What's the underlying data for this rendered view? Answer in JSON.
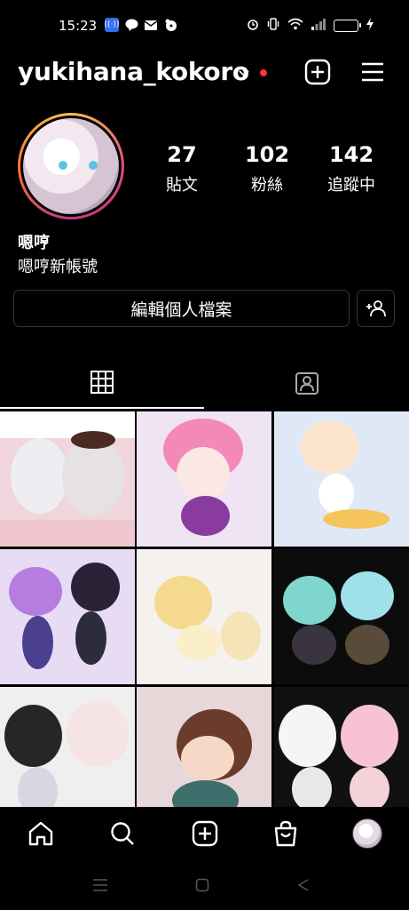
{
  "status_bar": {
    "time": "15:23",
    "left_icons": [
      "radio-icon",
      "line-icon",
      "mail-icon",
      "game-icon"
    ],
    "right_icons": [
      "alarm-icon",
      "vibrate-icon",
      "wifi-icon",
      "signal-icon",
      "battery-icon",
      "charging-icon"
    ]
  },
  "header": {
    "username": "yukihana_kokoro",
    "has_notification_dot": true,
    "notification_color": "#ff3040"
  },
  "profile": {
    "stats": [
      {
        "value": "27",
        "label": "貼文"
      },
      {
        "value": "102",
        "label": "粉絲"
      },
      {
        "value": "142",
        "label": "追蹤中"
      }
    ],
    "display_name": "嗯哼",
    "bio": "嗯哼新帳號",
    "edit_button_label": "編輯個人檔案"
  },
  "tabs": [
    {
      "name": "grid-tab",
      "icon": "grid-icon",
      "active": true
    },
    {
      "name": "tagged-tab",
      "icon": "tagged-person-icon",
      "active": false
    }
  ],
  "grid_posts": [
    {
      "theme": "two white-haired girls",
      "multi": true
    },
    {
      "theme": "pink-haired boy",
      "multi": false
    },
    {
      "theme": "blonde boy on skateboard",
      "multi": false
    },
    {
      "theme": "purple and black hair couple",
      "multi": false
    },
    {
      "theme": "fox creature",
      "multi": false
    },
    {
      "theme": "bunny-eared pair with guitar",
      "multi": false
    },
    {
      "theme": "cat and rabbit characters",
      "multi": false
    },
    {
      "theme": "happy birthday character",
      "multi": false
    },
    {
      "theme": "black and pink cat-eared pair",
      "multi": false
    }
  ],
  "bottom_nav": [
    "home-icon",
    "search-icon",
    "new-post-icon",
    "shop-icon",
    "profile-avatar"
  ],
  "colors": {
    "background": "#000000",
    "accent_red": "#ff3040",
    "border": "#363636"
  }
}
